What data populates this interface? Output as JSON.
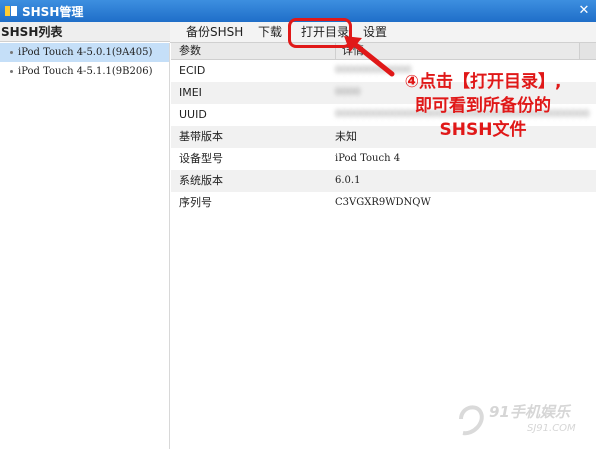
{
  "window": {
    "title": "SHSH管理",
    "close_glyph": "✕"
  },
  "sidebar": {
    "header": "SHSH列表",
    "items": [
      {
        "label": "iPod Touch 4-5.0.1(9A405)",
        "selected": true
      },
      {
        "label": "iPod Touch 4-5.1.1(9B206)",
        "selected": false
      }
    ]
  },
  "toolbar": {
    "tabs": [
      {
        "label": "备份SHSH"
      },
      {
        "label": "下载"
      },
      {
        "label": "打开目录"
      },
      {
        "label": "设置"
      }
    ]
  },
  "table": {
    "headers": [
      "参数",
      "详情"
    ],
    "rows": [
      {
        "label": "ECID",
        "value": "000000000000",
        "redacted": true
      },
      {
        "label": "IMEI",
        "value": "0000",
        "redacted": true
      },
      {
        "label": "UUID",
        "value": "0000000000000000000000000000000000000000",
        "redacted": true
      },
      {
        "label": "基带版本",
        "value": "未知",
        "redacted": false
      },
      {
        "label": "设备型号",
        "value": "iPod Touch 4",
        "redacted": false
      },
      {
        "label": "系统版本",
        "value": "6.0.1",
        "redacted": false
      },
      {
        "label": "序列号",
        "value": "C3VGXR9WDNQW",
        "redacted": false
      }
    ]
  },
  "annotation": {
    "lines": [
      "④点击【打开目录】,",
      "即可看到所备份的",
      "SHSH文件"
    ],
    "color": "#e01818"
  },
  "watermark": {
    "main": "91手机娱乐",
    "sub": "SJ91.COM"
  },
  "colors": {
    "titlebar": "#2a7bd3",
    "selection": "#c5dff8",
    "accent_red": "#e01818"
  }
}
